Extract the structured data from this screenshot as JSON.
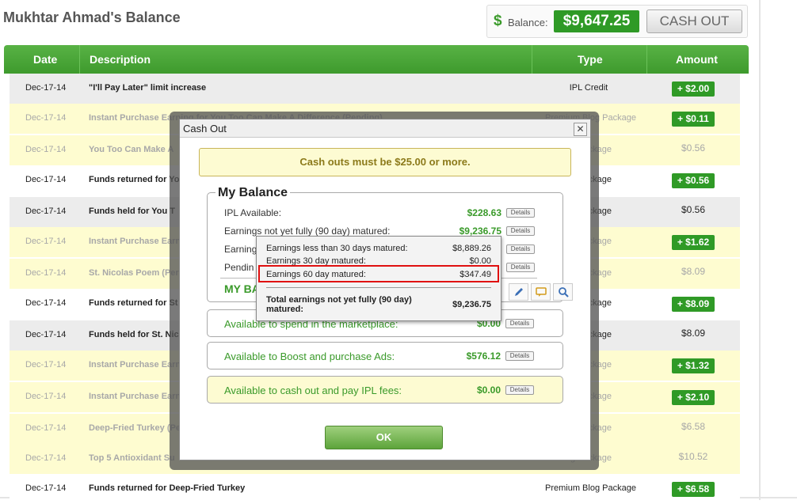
{
  "page": {
    "title": "Mukhtar Ahmad's Balance"
  },
  "balance": {
    "label": "Balance:",
    "value": "$9,647.25",
    "cashout_label": "CASH OUT",
    "icon": "dollar-icon"
  },
  "table": {
    "headers": {
      "date": "Date",
      "description": "Description",
      "type": "Type",
      "amount": "Amount"
    },
    "rows": [
      {
        "date": "Dec-17-14",
        "desc": "\"I'll Pay Later\" limit increase",
        "type": "IPL Credit",
        "amount": "+ $2.00",
        "badge": true
      },
      {
        "date": "Dec-17-14",
        "desc": "Instant Purchase Earning for You Too Can Make A Difference (Pending)",
        "type": "Premium Blog Package",
        "amount": "+ $0.11",
        "badge": true
      },
      {
        "date": "Dec-17-14",
        "desc": "You Too Can Make A",
        "type": "og Package",
        "amount": "$0.56",
        "badge": false
      },
      {
        "date": "Dec-17-14",
        "desc": "Funds returned for Yo",
        "type": "og Package",
        "amount": "+ $0.56",
        "badge": true
      },
      {
        "date": "Dec-17-14",
        "desc": "Funds held for You T",
        "type": "og Package",
        "amount": "$0.56",
        "badge": false
      },
      {
        "date": "Dec-17-14",
        "desc": "Instant Purchase Earn",
        "type": "og Package",
        "amount": "+ $1.62",
        "badge": true
      },
      {
        "date": "Dec-17-14",
        "desc": "St. Nicolas Poem (Per",
        "type": "og Package",
        "amount": "$8.09",
        "badge": false
      },
      {
        "date": "Dec-17-14",
        "desc": "Funds returned for St",
        "type": "og Package",
        "amount": "+ $8.09",
        "badge": true
      },
      {
        "date": "Dec-17-14",
        "desc": "Funds held for St. Nic",
        "type": "og Package",
        "amount": "$8.09",
        "badge": false
      },
      {
        "date": "Dec-17-14",
        "desc": "Instant Purchase Earn",
        "type": "og Package",
        "amount": "+ $1.32",
        "badge": true
      },
      {
        "date": "Dec-17-14",
        "desc": "Instant Purchase Earn",
        "type": "og Package",
        "amount": "+ $2.10",
        "badge": true
      },
      {
        "date": "Dec-17-14",
        "desc": "Deep-Fried Turkey (Pe",
        "type": "og Package",
        "amount": "$6.58",
        "badge": false
      },
      {
        "date": "Dec-17-14",
        "desc": "Top 5 Antioxidant Su",
        "type": "og Package",
        "amount": "$10.52",
        "badge": false
      },
      {
        "date": "Dec-17-14",
        "desc": "Funds returned for Deep-Fried Turkey",
        "type": "Premium Blog Package",
        "amount": "+ $6.58",
        "badge": true
      }
    ]
  },
  "dialog": {
    "title": "Cash Out",
    "close": "✕",
    "notice": "Cash outs must be $25.00 or more.",
    "my_balance": {
      "legend": "My Balance",
      "lines": [
        {
          "label": "IPL Available:",
          "value": "$228.63",
          "details": "Details"
        },
        {
          "label": "Earnings not yet fully (90 day) matured:",
          "value": "$9,236.75",
          "details": "Details"
        },
        {
          "label": "Earning",
          "value": "",
          "details": "Details"
        },
        {
          "label": "Pendin",
          "value": "",
          "details": "Details"
        }
      ],
      "partial_heading": "MY BA"
    },
    "spend": {
      "label": "Available to spend in the marketplace:",
      "value": "$0.00",
      "details": "Details"
    },
    "boost": {
      "label": "Available to Boost and purchase Ads:",
      "value": "$576.12",
      "details": "Details"
    },
    "cashout": {
      "label": "Available to cash out and pay IPL fees:",
      "value": "$0.00",
      "details": "Details"
    },
    "ok_label": "OK"
  },
  "tooltip": {
    "lines": [
      {
        "label": "Earnings less than 30 days matured:",
        "value": "$8,889.26"
      },
      {
        "label": "Earnings 30 day matured:",
        "value": "$0.00"
      },
      {
        "label": "Earnings 60 day matured:",
        "value": "$347.49"
      }
    ],
    "total_label": "Total earnings not yet fully (90 day) matured:",
    "total_value": "$9,236.75"
  },
  "colors": {
    "accent_green": "#2f9a26",
    "highlight_red": "#e01010",
    "notice_yellow": "#fdfbd2"
  }
}
